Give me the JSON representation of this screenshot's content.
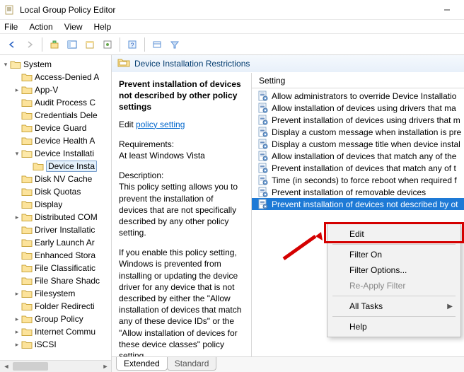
{
  "window": {
    "title": "Local Group Policy Editor",
    "min_icon": "—"
  },
  "menu": {
    "file": "File",
    "action": "Action",
    "view": "View",
    "help": "Help"
  },
  "tree": {
    "root": "System",
    "items": [
      {
        "label": "Access-Denied A",
        "depth": 1,
        "twist": ""
      },
      {
        "label": "App-V",
        "depth": 1,
        "twist": ">"
      },
      {
        "label": "Audit Process C",
        "depth": 1,
        "twist": ""
      },
      {
        "label": "Credentials Dele",
        "depth": 1,
        "twist": ""
      },
      {
        "label": "Device Guard",
        "depth": 1,
        "twist": ""
      },
      {
        "label": "Device Health A",
        "depth": 1,
        "twist": ""
      },
      {
        "label": "Device Installati",
        "depth": 1,
        "twist": "v",
        "open": true
      },
      {
        "label": "Device Insta",
        "depth": 2,
        "twist": "",
        "selected": true
      },
      {
        "label": "Disk NV Cache",
        "depth": 1,
        "twist": ""
      },
      {
        "label": "Disk Quotas",
        "depth": 1,
        "twist": ""
      },
      {
        "label": "Display",
        "depth": 1,
        "twist": ""
      },
      {
        "label": "Distributed COM",
        "depth": 1,
        "twist": ">"
      },
      {
        "label": "Driver Installatic",
        "depth": 1,
        "twist": ""
      },
      {
        "label": "Early Launch Ar",
        "depth": 1,
        "twist": ""
      },
      {
        "label": "Enhanced Stora",
        "depth": 1,
        "twist": ""
      },
      {
        "label": "File Classificatic",
        "depth": 1,
        "twist": ""
      },
      {
        "label": "File Share Shadc",
        "depth": 1,
        "twist": ""
      },
      {
        "label": "Filesystem",
        "depth": 1,
        "twist": ">"
      },
      {
        "label": "Folder Redirecti",
        "depth": 1,
        "twist": ""
      },
      {
        "label": "Group Policy",
        "depth": 1,
        "twist": ">"
      },
      {
        "label": "Internet Commu",
        "depth": 1,
        "twist": ">"
      },
      {
        "label": "iSCSI",
        "depth": 1,
        "twist": ">"
      }
    ]
  },
  "header": {
    "title": "Device Installation Restrictions"
  },
  "desc": {
    "policy": "Prevent installation of devices not described by other policy settings",
    "editprefix": "Edit ",
    "editlink": "policy setting ",
    "req_label": "Requirements:",
    "req_value": "At least Windows Vista",
    "descr_label": "Description:",
    "descr_p1": "This policy setting allows you to prevent the installation of devices that are not specifically described by any other policy setting.",
    "descr_p2": "If you enable this policy setting, Windows is prevented from installing or updating the device driver for any device that is not described by either the \"Allow installation of devices that match any of these device IDs\" or the \"Allow installation of devices for these device classes\" policy setting."
  },
  "list": {
    "col": "Setting",
    "items": [
      {
        "label": "Allow administrators to override Device Installatio"
      },
      {
        "label": "Allow installation of devices using drivers that ma"
      },
      {
        "label": "Prevent installation of devices using drivers that m"
      },
      {
        "label": "Display a custom message when installation is pre"
      },
      {
        "label": "Display a custom message title when device instal"
      },
      {
        "label": "Allow installation of devices that match any of the"
      },
      {
        "label": "Prevent installation of devices that match any of t"
      },
      {
        "label": "Time (in seconds) to force reboot when required f"
      },
      {
        "label": "Prevent installation of removable devices"
      },
      {
        "label": "Prevent installation of devices not described by ot",
        "selected": true
      }
    ]
  },
  "tabs": {
    "extended": "Extended",
    "standard": "Standard"
  },
  "ctx": {
    "edit": "Edit",
    "filteron": "Filter On",
    "filteropt": "Filter Options...",
    "reapply": "Re-Apply Filter",
    "alltasks": "All Tasks",
    "help": "Help"
  }
}
